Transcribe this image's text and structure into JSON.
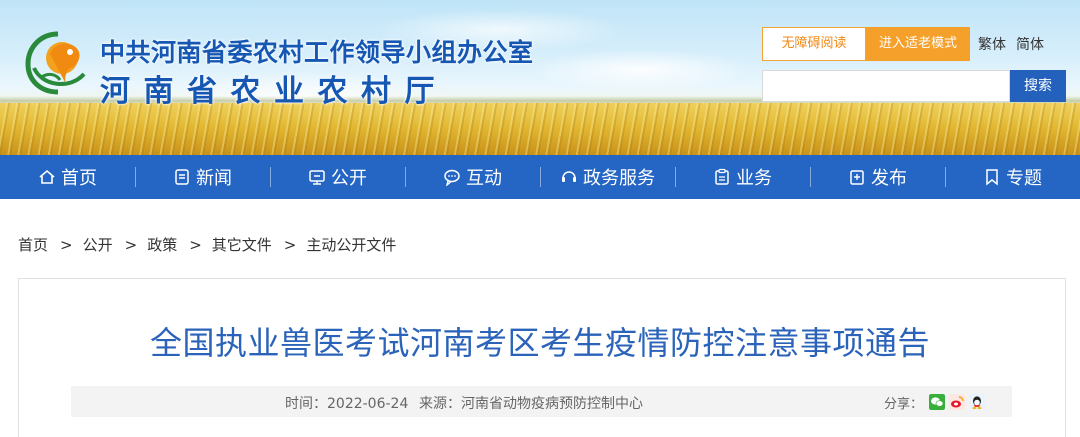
{
  "header": {
    "title_line1": "中共河南省委农村工作领导小组办公室",
    "title_line2": "河南省农业农村厅",
    "accessibility_label": "无障碍阅读",
    "elder_mode_label": "进入适老模式",
    "traditional_label": "繁体",
    "simplified_label": "简体",
    "search": {
      "placeholder": "",
      "value": "",
      "button_label": "搜索"
    }
  },
  "nav": {
    "items": [
      {
        "label": "首页",
        "icon": "home-icon"
      },
      {
        "label": "新闻",
        "icon": "news-icon"
      },
      {
        "label": "公开",
        "icon": "open-icon"
      },
      {
        "label": "互动",
        "icon": "chat-icon"
      },
      {
        "label": "政务服务",
        "icon": "service-icon"
      },
      {
        "label": "业务",
        "icon": "clipboard-icon"
      },
      {
        "label": "发布",
        "icon": "publish-icon"
      },
      {
        "label": "专题",
        "icon": "bookmark-icon"
      }
    ]
  },
  "breadcrumb": {
    "items": [
      "首页",
      "公开",
      "政策",
      "其它文件",
      "主动公开文件"
    ],
    "separator": ">"
  },
  "article": {
    "title": "全国执业兽医考试河南考区考生疫情防控注意事项通告",
    "time": "时间：2022-06-24",
    "source": "来源：河南省动物疫病预防控制中心",
    "share_label": "分享：",
    "share_icons": [
      "wechat-icon",
      "weibo-icon",
      "qq-icon"
    ]
  },
  "colors": {
    "brand_blue": "#2566c4",
    "title_blue": "#2a63b9",
    "accent_orange": "#f5a02a"
  }
}
